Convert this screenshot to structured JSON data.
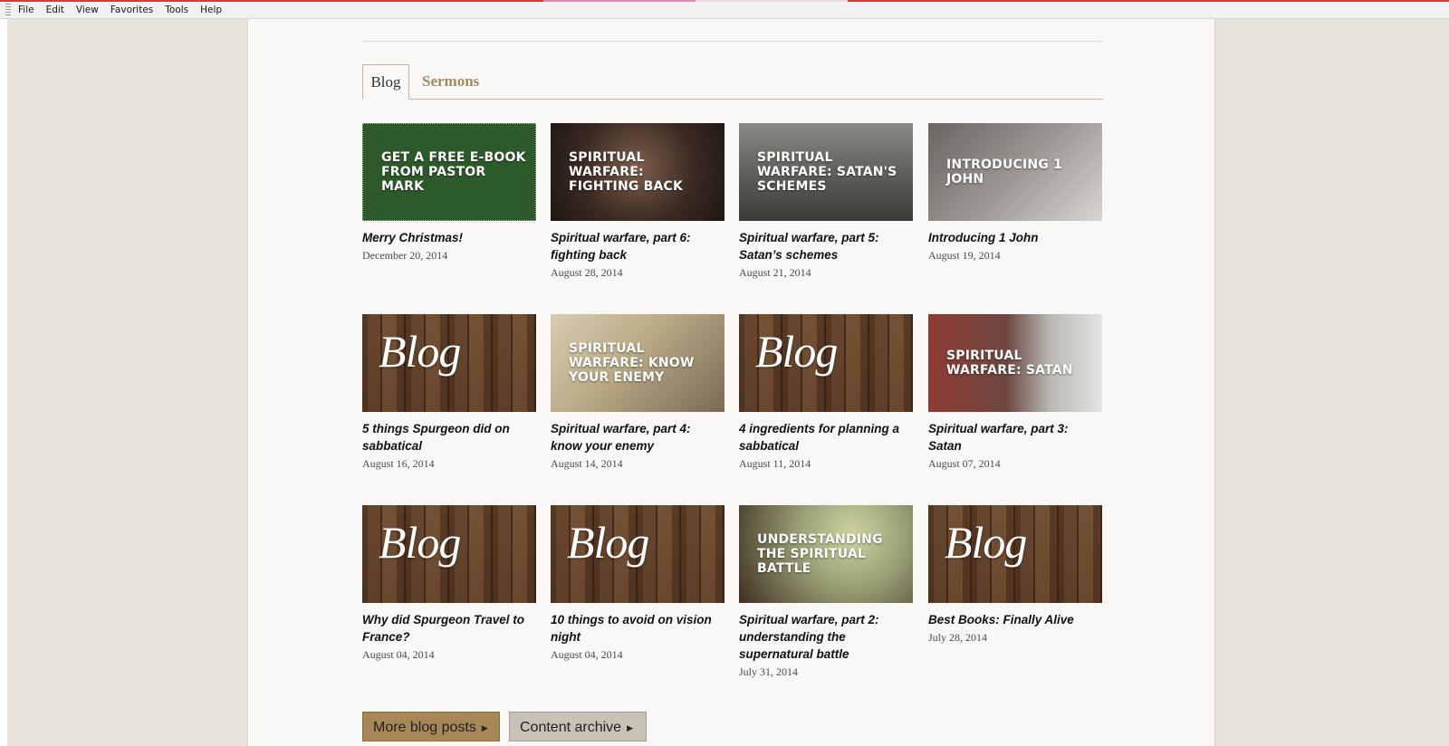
{
  "menu": {
    "items": [
      "File",
      "Edit",
      "View",
      "Favorites",
      "Tools",
      "Help"
    ]
  },
  "tabs": [
    {
      "label": "Blog",
      "active": true
    },
    {
      "label": "Sermons",
      "active": false
    }
  ],
  "posts": [
    {
      "image_text": "GET A FREE E-BOOK FROM PASTOR MARK",
      "image_style": "green",
      "title": "Merry Christmas!",
      "date": "December 20, 2014"
    },
    {
      "image_text": "SPIRITUAL WARFARE: FIGHTING BACK",
      "image_style": "dark",
      "title": "Spiritual warfare, part 6: fighting back",
      "date": "August 28, 2014"
    },
    {
      "image_text": "SPIRITUAL WARFARE: SATAN'S SCHEMES",
      "image_style": "grey",
      "title": "Spiritual warfare, part 5: Satan’s schemes",
      "date": "August 21, 2014"
    },
    {
      "image_text": "INTRODUCING 1 JOHN",
      "image_style": "grey2",
      "title": "Introducing 1 John",
      "date": "August 19, 2014"
    },
    {
      "image_text": "Blog",
      "image_style": "wood",
      "title": "5 things Spurgeon did on sabbatical",
      "date": "August 16, 2014"
    },
    {
      "image_text": "SPIRITUAL WARFARE: KNOW YOUR ENEMY",
      "image_style": "tan",
      "title": "Spiritual warfare, part 4: know your enemy",
      "date": "August 14, 2014"
    },
    {
      "image_text": "Blog",
      "image_style": "wood",
      "title": "4 ingredients for planning a sabbatical",
      "date": "August 11, 2014"
    },
    {
      "image_text": "SPIRITUAL WARFARE: SATAN",
      "image_style": "red",
      "title": "Spiritual warfare, part 3: Satan",
      "date": "August 07, 2014"
    },
    {
      "image_text": "Blog",
      "image_style": "wood",
      "title": "Why did Spurgeon Travel to France?",
      "date": "August 04, 2014"
    },
    {
      "image_text": "Blog",
      "image_style": "wood",
      "title": "10 things to avoid on vision night",
      "date": "August 04, 2014"
    },
    {
      "image_text": "UNDERSTANDING THE SPIRITUAL BATTLE",
      "image_style": "olive",
      "title": "Spiritual warfare, part 2: understanding the supernatural battle",
      "date": "July 31, 2014"
    },
    {
      "image_text": "Blog",
      "image_style": "wood",
      "title": "Best Books: Finally Alive",
      "date": "July 28, 2014"
    }
  ],
  "buttons": {
    "more_posts": "More blog posts",
    "content_archive": "Content archive"
  },
  "colors": {
    "tab_inactive": "#a38a5d",
    "primary_button": "#a88756",
    "secondary_button": "#c8c2b6"
  }
}
